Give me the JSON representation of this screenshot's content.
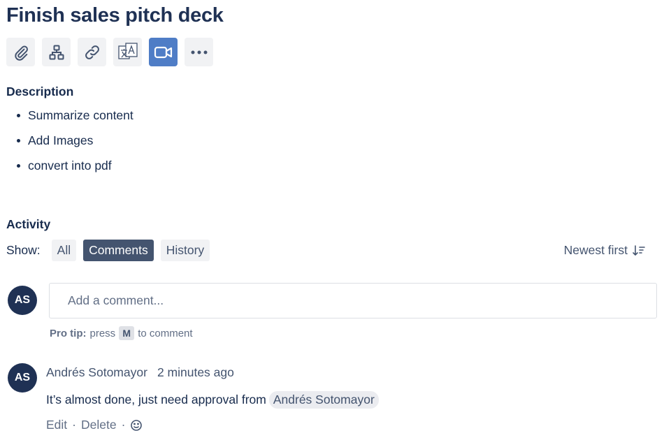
{
  "issue": {
    "title": "Finish sales pitch deck"
  },
  "toolbar": {
    "buttons": [
      {
        "icon": "attachment-icon"
      },
      {
        "icon": "child-issues-icon"
      },
      {
        "icon": "link-icon"
      },
      {
        "icon": "translate-icon"
      },
      {
        "icon": "video-icon",
        "accent": "#4f7dc6"
      },
      {
        "icon": "more-icon"
      }
    ]
  },
  "description": {
    "heading": "Description",
    "items": [
      "Summarize content",
      "Add Images",
      "convert into pdf"
    ]
  },
  "activity": {
    "heading": "Activity",
    "show_label": "Show:",
    "filters": [
      "All",
      "Comments",
      "History"
    ],
    "active_filter": "Comments",
    "sort_label": "Newest first"
  },
  "composer": {
    "avatar_initials": "AS",
    "placeholder": "Add a comment...",
    "protip_prefix": "Pro tip:",
    "protip_press": "press",
    "protip_key": "M",
    "protip_suffix": "to comment"
  },
  "comments": [
    {
      "avatar_initials": "AS",
      "author": "Andrés Sotomayor",
      "time": "2 minutes ago",
      "text": "It’s almost done, just need approval from",
      "mention": "Andrés Sotomayor",
      "actions": {
        "edit": "Edit",
        "delete": "Delete",
        "separator": "·"
      }
    }
  ],
  "colors": {
    "avatar_bg": "#1f3154",
    "active_chip": "#44546f",
    "video_button": "#4f7dc6"
  }
}
